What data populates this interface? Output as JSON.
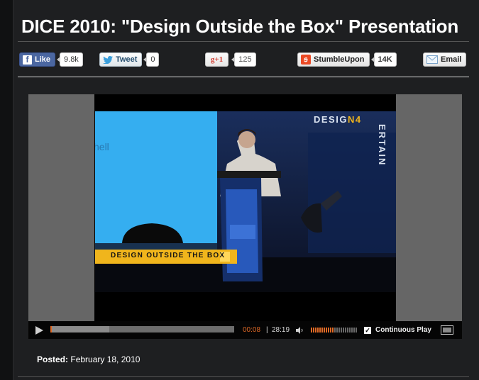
{
  "page": {
    "title": "DICE 2010: \"Design Outside the Box\" Presentation",
    "posted_label": "Posted:",
    "posted_date": "February 18, 2010"
  },
  "share": {
    "facebook": {
      "label": "Like",
      "count": "9.8k"
    },
    "twitter": {
      "label": "Tweet",
      "count": "0"
    },
    "google": {
      "label": "+1",
      "count": "125"
    },
    "stumbleupon": {
      "label": "StumbleUpon",
      "count": "14K"
    },
    "email": {
      "label": "Email"
    }
  },
  "video": {
    "slide_text": "hell",
    "banner_text": "DESIGN OUTSIDE THE BOX",
    "backdrop_logo": "DESIG",
    "backdrop_logo_accent": "N4",
    "backdrop_vertical": "ERTAIN",
    "current_time": "00:08",
    "separator": "|",
    "total_time": "28:19",
    "continuous_play_label": "Continuous Play",
    "continuous_play_checked": true,
    "progress": 0.005,
    "buffered": 0.32,
    "volume_level": 0.5
  },
  "colors": {
    "accent_orange": "#e06a26",
    "facebook_blue": "#4b67a1",
    "banner_yellow": "#f0b51c"
  }
}
